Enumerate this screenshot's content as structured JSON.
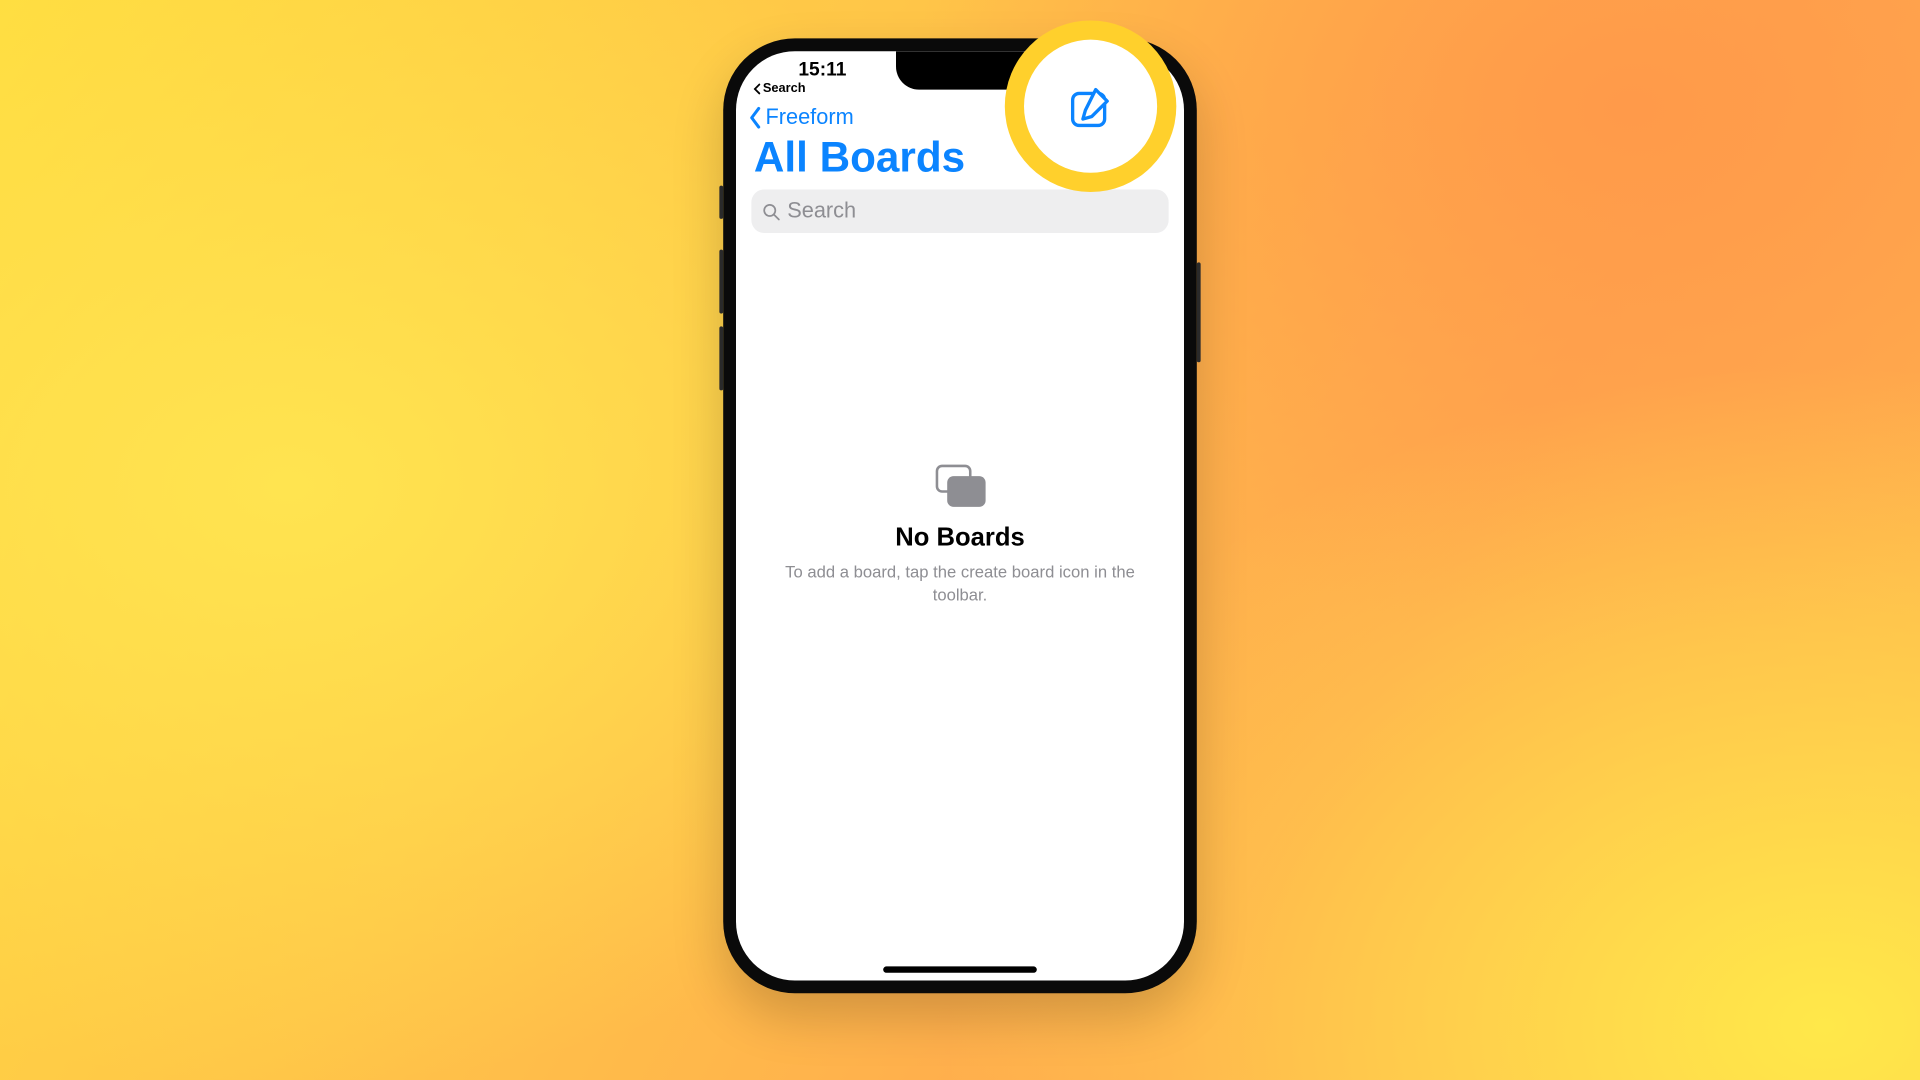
{
  "status": {
    "time": "15:11",
    "back_link": "Search"
  },
  "nav": {
    "back_label": "Freeform"
  },
  "title": "All Boards",
  "search": {
    "placeholder": "Search"
  },
  "empty": {
    "title": "No Boards",
    "subtitle": "To add a board, tap the create board icon in the toolbar."
  },
  "colors": {
    "accent": "#0b84ff",
    "highlight_ring": "#ffd02c"
  }
}
